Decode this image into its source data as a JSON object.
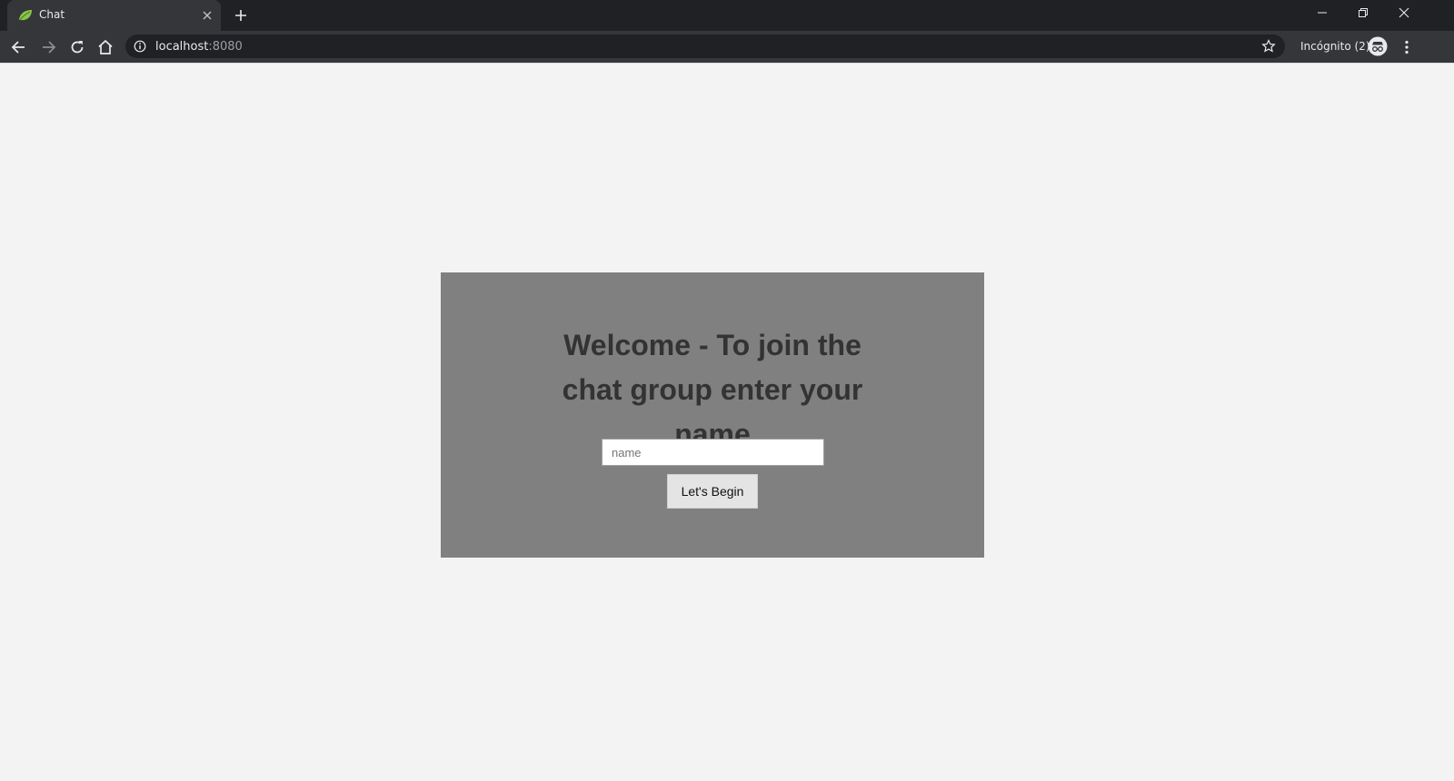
{
  "browser": {
    "tab": {
      "title": "Chat"
    },
    "address": {
      "host": "localhost",
      "port": ":8080"
    },
    "profile": {
      "label": "Incógnito (2)"
    }
  },
  "icons": {
    "tab_favicon": "spring-leaf-icon",
    "tab_close": "close-icon",
    "new_tab": "plus-icon",
    "back": "arrow-left-icon",
    "forward": "arrow-right-icon",
    "reload": "reload-icon",
    "home": "home-icon",
    "site_info": "info-icon",
    "bookmark": "star-icon",
    "incognito": "incognito-icon",
    "menu": "kebab-menu-icon"
  },
  "login": {
    "heading": "Welcome - To join the chat group enter your name",
    "name_placeholder": "name",
    "name_value": "",
    "begin_label": "Let's Begin"
  },
  "colors": {
    "page_background": "#f3f3f3",
    "card_background": "#808080",
    "heading_text": "#333333",
    "chrome_dark": "#202124",
    "chrome_toolbar": "#35363a",
    "favicon_green": "#8bc34a"
  }
}
